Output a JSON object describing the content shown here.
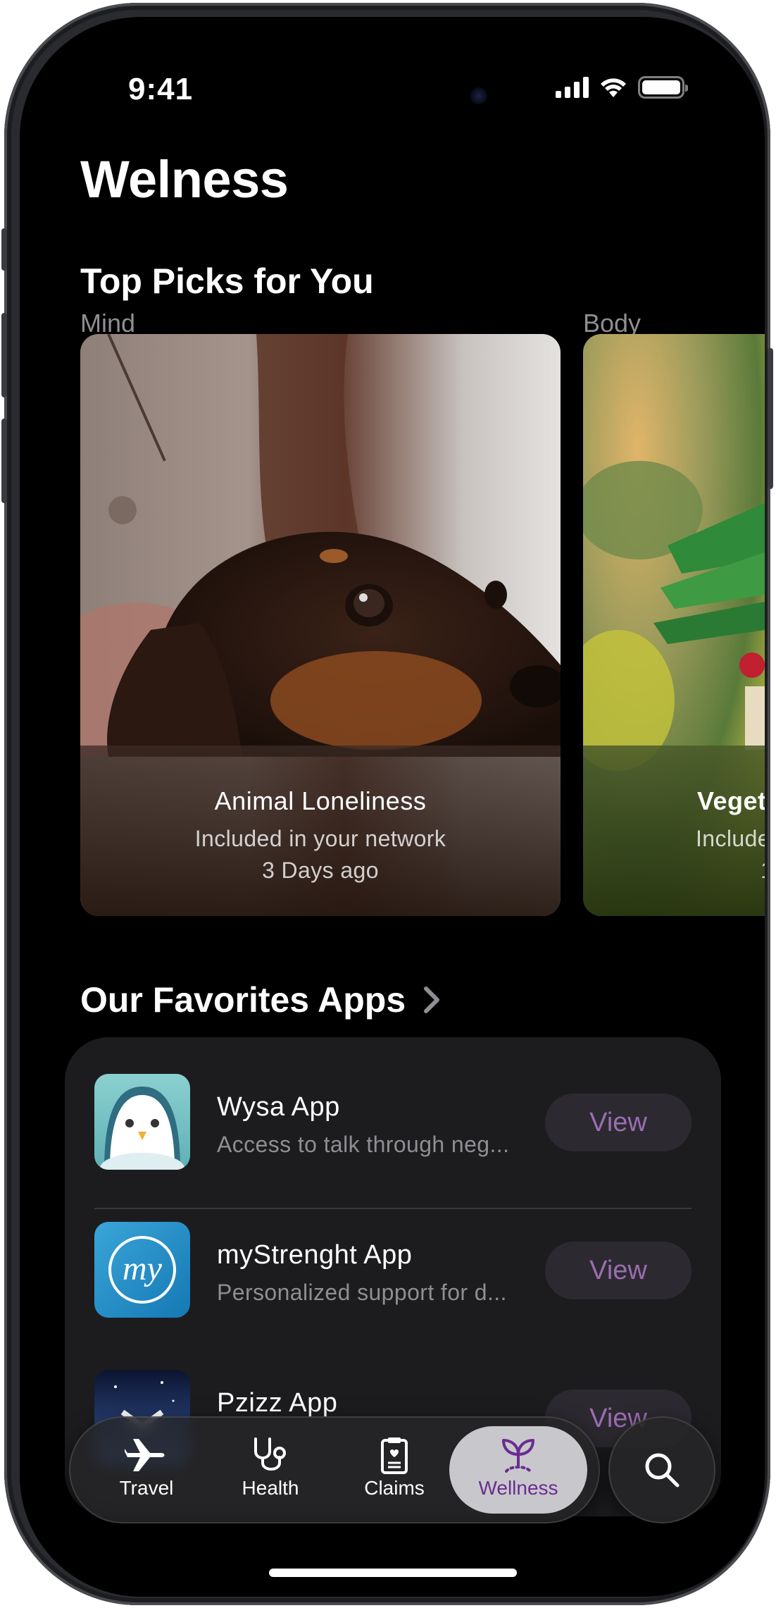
{
  "status": {
    "time": "9:41"
  },
  "page": {
    "title": "Welness"
  },
  "top_picks": {
    "title": "Top Picks for You",
    "cards": [
      {
        "category": "Mind",
        "title": "Animal Loneliness",
        "subtitle": "Included in your network",
        "time": "3 Days ago"
      },
      {
        "category": "Body",
        "title": "Veget",
        "subtitle": "Include",
        "time": "1"
      }
    ]
  },
  "favorites": {
    "title": "Our Favorites Apps",
    "apps": [
      {
        "name": "Wysa App",
        "description": "Access to talk through neg...",
        "button": "View"
      },
      {
        "name": "myStrenght App",
        "description": "Personalized support for d...",
        "button": "View",
        "icon_text": "my"
      },
      {
        "name": "Pzizz App",
        "description": "",
        "button": "View"
      }
    ]
  },
  "tabbar": {
    "tabs": [
      {
        "label": "Travel",
        "icon": "airplane-icon"
      },
      {
        "label": "Health",
        "icon": "stethoscope-icon"
      },
      {
        "label": "Claims",
        "icon": "clipboard-icon"
      },
      {
        "label": "Wellness",
        "icon": "sprout-icon",
        "active": true
      }
    ],
    "search_icon": "search-icon"
  },
  "colors": {
    "accent": "#6b2d91",
    "view_text": "#9a6db0",
    "panel": "#1c1c1e"
  }
}
